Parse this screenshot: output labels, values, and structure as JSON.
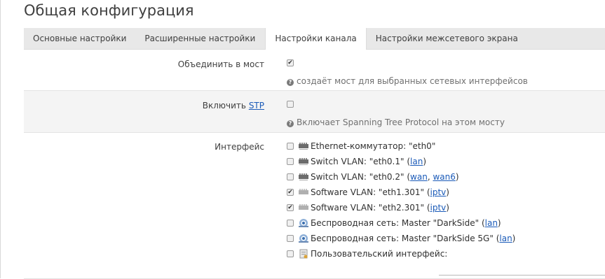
{
  "page": {
    "title": "Общая конфигурация"
  },
  "tabs": [
    {
      "label": "Основные настройки",
      "active": false
    },
    {
      "label": "Расширенные настройки",
      "active": false
    },
    {
      "label": "Настройки канала",
      "active": true
    },
    {
      "label": "Настройки межсетевого экрана",
      "active": false
    }
  ],
  "bridge": {
    "label": "Объединить в мост",
    "checked": true,
    "help": "создаёт мост для выбранных сетевых интерфейсов"
  },
  "stp": {
    "label_prefix": "Включить",
    "label_link": "STP",
    "checked": false,
    "help": "Включает Spanning Tree Protocol на этом мосту"
  },
  "interface": {
    "label": "Интерфейс",
    "items": [
      {
        "icon": "ethernet-switch-icon",
        "checked": false,
        "text": "Ethernet-коммутатор: \"eth0\"",
        "links": []
      },
      {
        "icon": "ethernet-switch-icon",
        "checked": false,
        "text": "Switch VLAN: \"eth0.1\"",
        "links": [
          "lan"
        ]
      },
      {
        "icon": "ethernet-switch-icon",
        "checked": false,
        "text": "Switch VLAN: \"eth0.2\"",
        "links": [
          "wan",
          "wan6"
        ]
      },
      {
        "icon": "vlan-icon",
        "checked": true,
        "text": "Software VLAN: \"eth1.301\"",
        "links": [
          "iptv"
        ]
      },
      {
        "icon": "vlan-icon",
        "checked": true,
        "text": "Software VLAN: \"eth2.301\"",
        "links": [
          "iptv"
        ]
      },
      {
        "icon": "wifi-icon",
        "checked": false,
        "text": "Беспроводная сеть: Master \"DarkSide\"",
        "links": [
          "lan"
        ]
      },
      {
        "icon": "wifi-icon",
        "checked": false,
        "text": "Беспроводная сеть: Master \"DarkSide 5G\"",
        "links": [
          "lan"
        ]
      },
      {
        "icon": "custom-interface-icon",
        "checked": false,
        "text": "Пользовательский интерфейс:",
        "links": []
      }
    ]
  },
  "colors": {
    "link": "#1a5ab8",
    "tabbar": "#e8e8e8",
    "alt_row": "#f4f4f4"
  }
}
